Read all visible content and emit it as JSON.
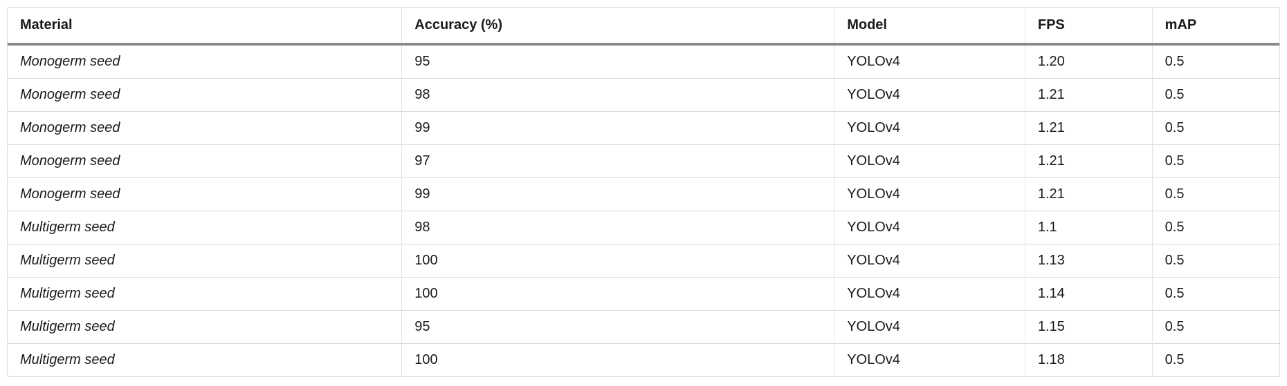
{
  "table": {
    "headers": [
      "Material",
      "Accuracy (%)",
      "Model",
      "FPS",
      "mAP"
    ],
    "rows": [
      {
        "material": "Monogerm seed",
        "accuracy": "95",
        "model": "YOLOv4",
        "fps": "1.20",
        "map": "0.5"
      },
      {
        "material": "Monogerm seed",
        "accuracy": "98",
        "model": "YOLOv4",
        "fps": "1.21",
        "map": "0.5"
      },
      {
        "material": "Monogerm seed",
        "accuracy": "99",
        "model": "YOLOv4",
        "fps": "1.21",
        "map": "0.5"
      },
      {
        "material": "Monogerm seed",
        "accuracy": "97",
        "model": "YOLOv4",
        "fps": "1.21",
        "map": "0.5"
      },
      {
        "material": "Monogerm seed",
        "accuracy": "99",
        "model": "YOLOv4",
        "fps": "1.21",
        "map": "0.5"
      },
      {
        "material": "Multigerm seed",
        "accuracy": "98",
        "model": "YOLOv4",
        "fps": "1.1",
        "map": "0.5"
      },
      {
        "material": "Multigerm seed",
        "accuracy": "100",
        "model": "YOLOv4",
        "fps": "1.13",
        "map": "0.5"
      },
      {
        "material": "Multigerm seed",
        "accuracy": "100",
        "model": "YOLOv4",
        "fps": "1.14",
        "map": "0.5"
      },
      {
        "material": "Multigerm seed",
        "accuracy": "95",
        "model": "YOLOv4",
        "fps": "1.15",
        "map": "0.5"
      },
      {
        "material": "Multigerm seed",
        "accuracy": "100",
        "model": "YOLOv4",
        "fps": "1.18",
        "map": "0.5"
      }
    ]
  }
}
